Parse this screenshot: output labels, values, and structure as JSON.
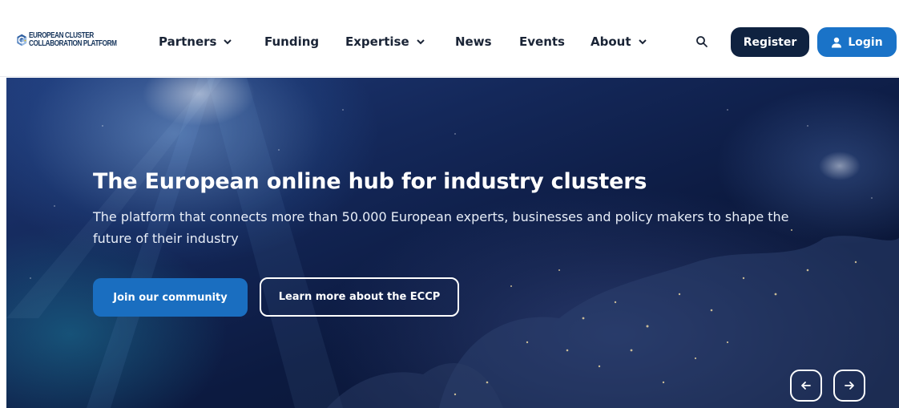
{
  "header": {
    "logo": {
      "line1": "EUROPEAN CLUSTER",
      "line2": "COLLABORATION PLATFORM"
    },
    "nav": [
      {
        "label": "Partners",
        "has_dropdown": true
      },
      {
        "label": "Funding",
        "has_dropdown": false
      },
      {
        "label": "Expertise",
        "has_dropdown": true
      },
      {
        "label": "News",
        "has_dropdown": false
      },
      {
        "label": "Events",
        "has_dropdown": false
      },
      {
        "label": "About",
        "has_dropdown": true
      }
    ],
    "search_icon": "search-icon",
    "register_label": "Register",
    "login_label": "Login",
    "login_icon": "user-icon"
  },
  "hero": {
    "title": "The European online hub for industry clusters",
    "subtitle": "The platform that connects more than 50.000 European experts, businesses and policy makers to shape the future of their industry",
    "primary_button": "Join our community",
    "secondary_button": "Learn more about the ECCP",
    "prev_icon": "arrow-left-icon",
    "next_icon": "arrow-right-icon"
  },
  "colors": {
    "brand_dark": "#0f2240",
    "brand_blue": "#1a73c8",
    "hero_bg": "#0c1a40"
  }
}
